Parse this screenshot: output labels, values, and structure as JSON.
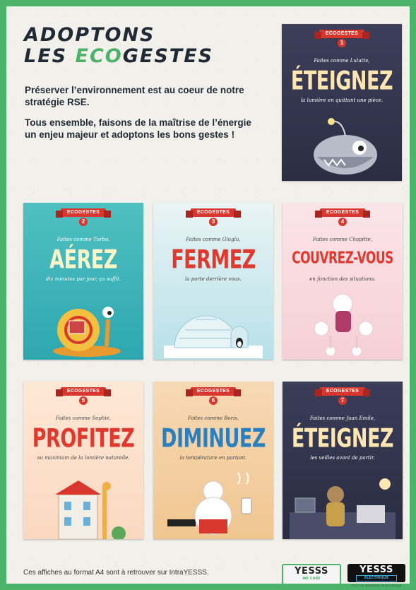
{
  "header": {
    "title_line1": "ADOPTONS",
    "title_line2_start": "LES ",
    "title_line2_accent": "ECO",
    "title_line2_end": "GESTES"
  },
  "intro": {
    "paragraph1": "Préserver l’environnement est au coeur de notre stratégie RSE.",
    "paragraph2": "Tous ensemble, faisons de la maîtrise de l’énergie un enjeu majeur et adoptons les bons gestes !"
  },
  "posters": [
    {
      "banner": "ECOGESTES",
      "number": "1",
      "pre": "Faites comme Lulutte,",
      "verb": "ÉTEIGNEZ",
      "sub": "la lumière en quittant une pièce."
    },
    {
      "banner": "ECOGESTES",
      "number": "2",
      "pre": "Faites comme Turbo,",
      "verb": "AÉREZ",
      "sub": "dix minutes par jour, ça suffit."
    },
    {
      "banner": "ECOGESTES",
      "number": "3",
      "pre": "Faites comme Gluglu,",
      "verb": "FERMEZ",
      "sub": "la porte derrière vous."
    },
    {
      "banner": "ECOGESTES",
      "number": "4",
      "pre": "Faites comme Chapitte,",
      "verb": "COUVREZ-VOUS",
      "sub": "en fonction des situations."
    },
    {
      "banner": "ECOGESTES",
      "number": "5",
      "pre": "Faites comme Sophie,",
      "verb": "PROFITEZ",
      "sub": "au maximum de la lumière naturelle."
    },
    {
      "banner": "ECOGESTES",
      "number": "6",
      "pre": "Faites comme Boris,",
      "verb": "DIMINUEZ",
      "sub": "la température en partant."
    },
    {
      "banner": "ECOGESTES",
      "number": "7",
      "pre": "Faites comme Juan Emile,",
      "verb": "ÉTEIGNEZ",
      "sub": "les veilles avant de partir."
    }
  ],
  "footer": {
    "text": "Ces affiches au format A4 sont à retrouver sur IntraYESSS.",
    "logo1_main": "YESSS",
    "logo1_tag": "WE CARE",
    "logo2_main": "YESSS",
    "logo2_tag": "ELECTRIQUE",
    "logo2_caption": "TOUT LE MATÉRIEL ÉLECTRIQUE"
  },
  "colors": {
    "border_green": "#4cb46a",
    "title_navy": "#1f2a35",
    "banner_red": "#d8372d"
  }
}
